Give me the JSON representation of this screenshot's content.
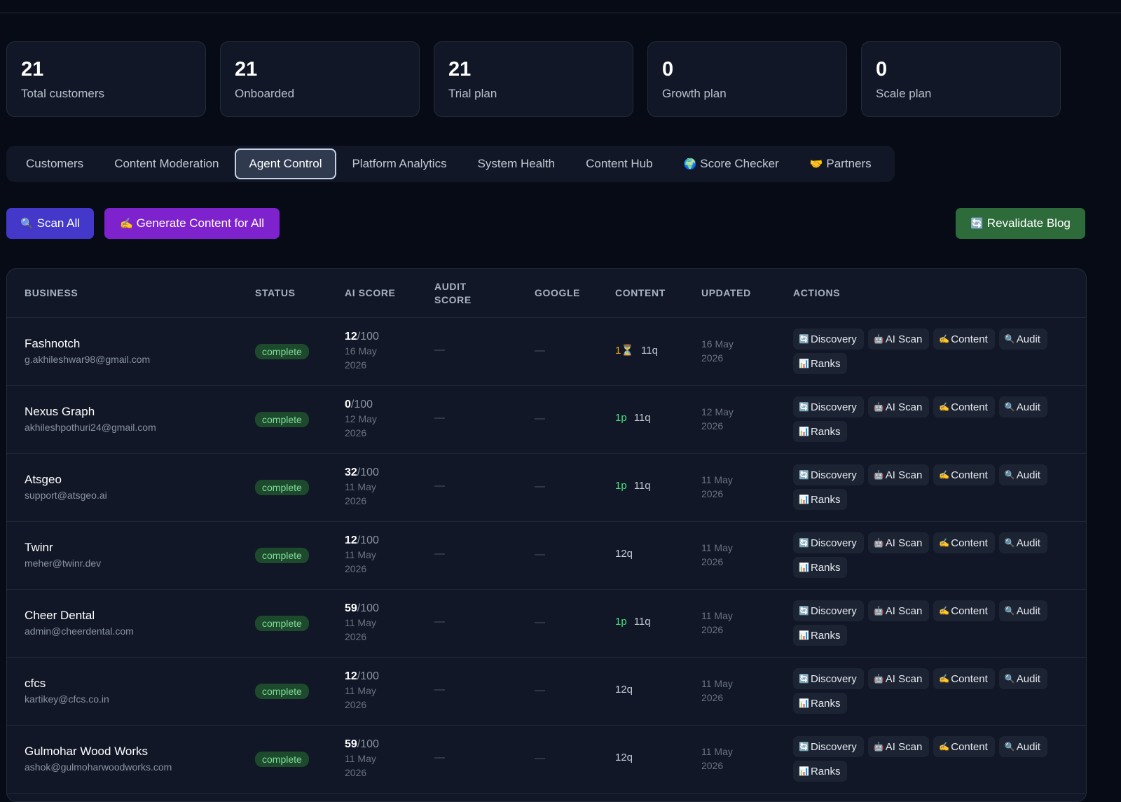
{
  "stats": [
    {
      "value": "21",
      "label": "Total customers"
    },
    {
      "value": "21",
      "label": "Onboarded"
    },
    {
      "value": "21",
      "label": "Trial plan"
    },
    {
      "value": "0",
      "label": "Growth plan"
    },
    {
      "value": "0",
      "label": "Scale plan"
    }
  ],
  "tabs": [
    {
      "label": "Customers",
      "icon": ""
    },
    {
      "label": "Content Moderation",
      "icon": ""
    },
    {
      "label": "Agent Control",
      "icon": "",
      "active": true
    },
    {
      "label": "Platform Analytics",
      "icon": ""
    },
    {
      "label": "System Health",
      "icon": ""
    },
    {
      "label": "Content Hub",
      "icon": ""
    },
    {
      "label": "Score Checker",
      "icon": "🌍"
    },
    {
      "label": "Partners",
      "icon": "🤝"
    }
  ],
  "toolbar": {
    "scan_all": "Scan All",
    "scan_icon": "🔍",
    "generate_all": "Generate Content for All",
    "generate_icon": "✍️",
    "revalidate": "Revalidate Blog",
    "revalidate_icon": "🔄"
  },
  "table": {
    "headers": {
      "business": "BUSINESS",
      "status": "STATUS",
      "ai_score": "AI SCORE",
      "audit_score_1": "AUDIT",
      "audit_score_2": "SCORE",
      "google": "GOOGLE",
      "content": "CONTENT",
      "updated": "UPDATED",
      "actions": "ACTIONS"
    },
    "action_labels": [
      {
        "icon": "🔄",
        "label": "Discovery"
      },
      {
        "icon": "🤖",
        "label": "AI Scan"
      },
      {
        "icon": "✍️",
        "label": "Content"
      },
      {
        "icon": "🔍",
        "label": "Audit"
      },
      {
        "icon": "📊",
        "label": "Ranks"
      }
    ],
    "rows": [
      {
        "name": "Fashnotch",
        "email": "g.akhileshwar98@gmail.com",
        "status": "complete",
        "score": "12",
        "score_max": "/100",
        "score_date_1": "16 May",
        "score_date_2": "2026",
        "audit": "—",
        "google": "—",
        "content_pages": "1⏳",
        "content_pages_color": "orange",
        "content_queries": "11q",
        "updated_1": "16 May",
        "updated_2": "2026"
      },
      {
        "name": "Nexus Graph",
        "email": "akhileshpothuri24@gmail.com",
        "status": "complete",
        "score": "0",
        "score_max": "/100",
        "score_date_1": "12 May",
        "score_date_2": "2026",
        "audit": "—",
        "google": "—",
        "content_pages": "1p",
        "content_pages_color": "green",
        "content_queries": "11q",
        "updated_1": "12 May",
        "updated_2": "2026"
      },
      {
        "name": "Atsgeo",
        "email": "support@atsgeo.ai",
        "status": "complete",
        "score": "32",
        "score_max": "/100",
        "score_date_1": "11 May",
        "score_date_2": "2026",
        "audit": "—",
        "google": "—",
        "content_pages": "1p",
        "content_pages_color": "green",
        "content_queries": "11q",
        "updated_1": "11 May",
        "updated_2": "2026"
      },
      {
        "name": "Twinr",
        "email": "meher@twinr.dev",
        "status": "complete",
        "score": "12",
        "score_max": "/100",
        "score_date_1": "11 May",
        "score_date_2": "2026",
        "audit": "—",
        "google": "—",
        "content_pages": "",
        "content_pages_color": "green",
        "content_queries": "12q",
        "updated_1": "11 May",
        "updated_2": "2026"
      },
      {
        "name": "Cheer Dental",
        "email": "admin@cheerdental.com",
        "status": "complete",
        "score": "59",
        "score_max": "/100",
        "score_date_1": "11 May",
        "score_date_2": "2026",
        "audit": "—",
        "google": "—",
        "content_pages": "1p",
        "content_pages_color": "green",
        "content_queries": "11q",
        "updated_1": "11 May",
        "updated_2": "2026"
      },
      {
        "name": "cfcs",
        "email": "kartikey@cfcs.co.in",
        "status": "complete",
        "score": "12",
        "score_max": "/100",
        "score_date_1": "11 May",
        "score_date_2": "2026",
        "audit": "—",
        "google": "—",
        "content_pages": "",
        "content_pages_color": "green",
        "content_queries": "12q",
        "updated_1": "11 May",
        "updated_2": "2026"
      },
      {
        "name": "Gulmohar Wood Works",
        "email": "ashok@gulmoharwoodworks.com",
        "status": "complete",
        "score": "59",
        "score_max": "/100",
        "score_date_1": "11 May",
        "score_date_2": "2026",
        "audit": "—",
        "google": "—",
        "content_pages": "",
        "content_pages_color": "green",
        "content_queries": "12q",
        "updated_1": "11 May",
        "updated_2": "2026"
      }
    ]
  },
  "colors": {
    "background": "#070b16",
    "card": "#111726",
    "scan_button": "#4338ca",
    "generate_button": "#7e22ce",
    "revalidate_button": "#2d6b3a",
    "status_badge": "#1d4a2c",
    "status_text": "#7fdc98"
  }
}
